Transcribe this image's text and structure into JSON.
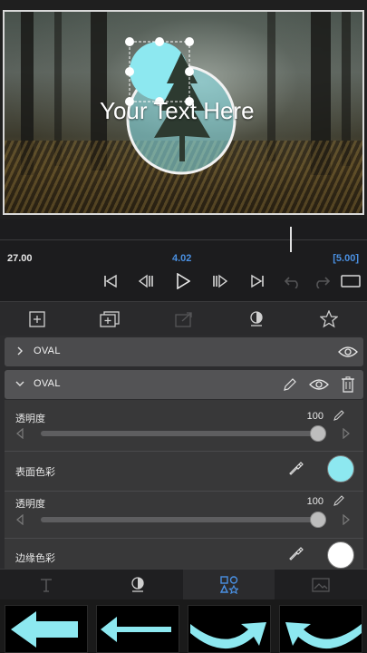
{
  "preview": {
    "overlay_text": "Your Text Here"
  },
  "timeline": {
    "start_time": "27.00",
    "current_time": "4.02",
    "end_time": "[5.00]"
  },
  "transport": {
    "icons": [
      "skip-to-start-icon",
      "step-back-icon",
      "play-icon",
      "step-forward-icon",
      "skip-to-end-icon",
      "undo-icon",
      "redo-icon",
      "aspect-icon"
    ]
  },
  "toolbar": {
    "icons": [
      "add-layer-icon",
      "duplicate-layer-icon",
      "replace-icon",
      "mask-icon",
      "favorite-icon"
    ]
  },
  "layers": [
    {
      "label": "OVAL",
      "expanded": false
    },
    {
      "label": "OVAL",
      "expanded": true
    }
  ],
  "properties": {
    "opacity_label": "透明度",
    "opacity_value": "100",
    "fill_color_label": "表面色彩",
    "fill_color": "#8de8f0",
    "border_opacity_label": "透明度",
    "border_opacity_value": "100",
    "border_color_label": "边缘色彩",
    "border_color": "#ffffff"
  },
  "bottom_tabs": [
    "text-tab-icon",
    "style-tab-icon",
    "shapes-tab-icon",
    "image-tab-icon"
  ],
  "active_tab": "shapes",
  "library": [
    "arrow-left-thick-icon",
    "arrow-left-thin-icon",
    "arrow-curved-right-icon",
    "arrow-curved-left-icon"
  ],
  "colors": {
    "accent_blue": "#4a90e2",
    "shape_cyan": "#8de8f0"
  }
}
